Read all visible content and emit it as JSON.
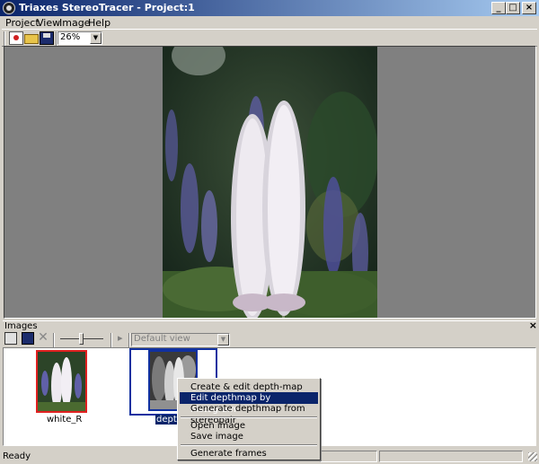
{
  "window": {
    "title": "Triaxes StereoTracer - Project:1",
    "min_glyph": "_",
    "max_glyph": "□",
    "close_glyph": "×"
  },
  "menu": {
    "project": "Project",
    "view": "View",
    "image": "Image",
    "help": "Help"
  },
  "toolbar": {
    "zoom_value": "26%"
  },
  "images_panel": {
    "title": "Images",
    "close_glyph": "×",
    "view_select": "Default view",
    "play_glyph": "▸"
  },
  "thumbnails": [
    {
      "label": "white_R"
    },
    {
      "label": "depthm"
    }
  ],
  "context_menu": {
    "items": [
      "Create & edit depth-map",
      "Edit depthmap by histogram",
      "Generate depthmap from stereopair",
      "Open image",
      "Save image",
      "Generate frames"
    ],
    "highlighted_index": 1
  },
  "status": {
    "text": "Ready"
  },
  "colors": {
    "title_start": "#0a246a",
    "title_end": "#a6caf0",
    "selection": "#0a246a",
    "canvas_bg": "#808080",
    "thumb_border_red": "#e02020",
    "thumb_border_blue": "#1030a0"
  }
}
